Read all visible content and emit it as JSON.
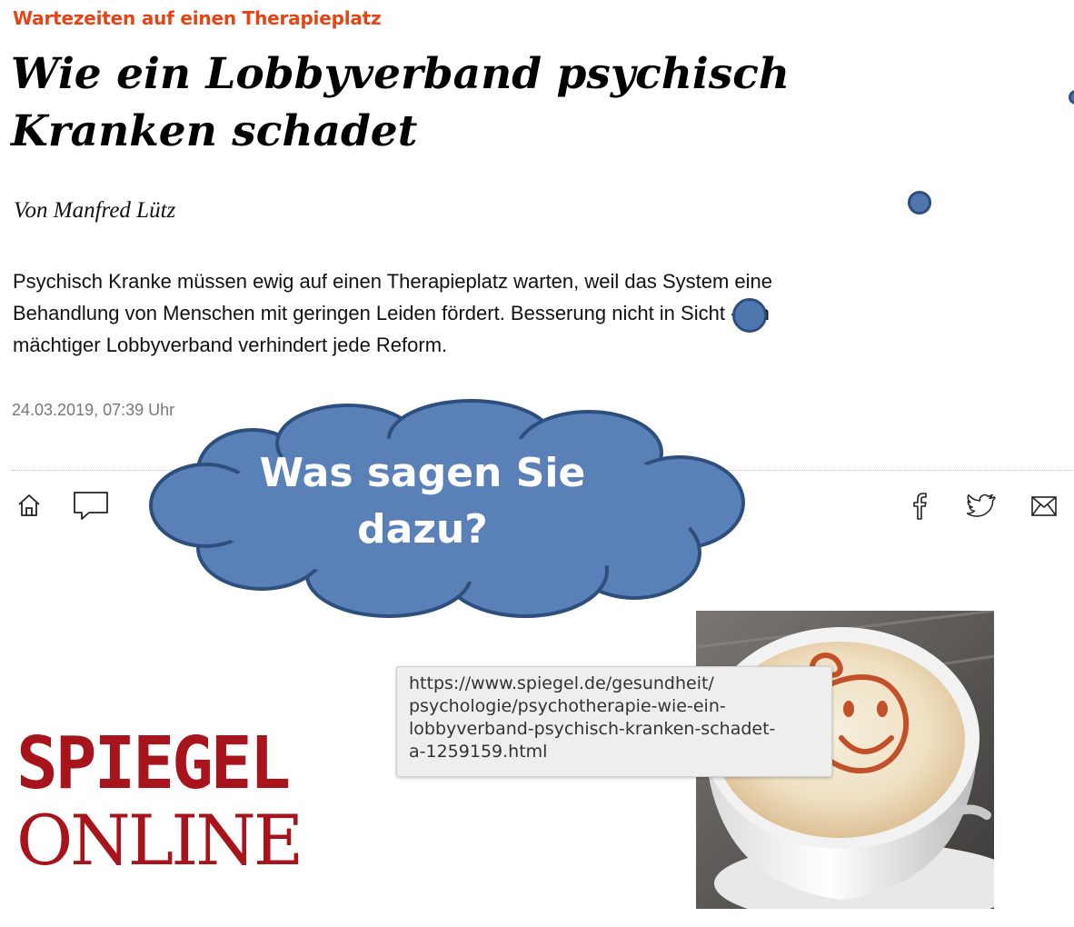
{
  "article": {
    "kicker": "Wartezeiten auf einen Therapieplatz",
    "headline": "Wie ein Lobbyverband psychisch Kranken schadet",
    "author": "Von Manfred Lütz",
    "teaser": "Psychisch Kranke müssen ewig auf einen Therapieplatz warten, weil das System eine Behandlung von Menschen mit geringen Leiden fördert. Besserung nicht in Sicht - ein mächtiger Lobbyverband verhindert jede Reform.",
    "date": "24.03.2019, 07:39 Uhr"
  },
  "toolbar": {
    "left_icons": [
      "home-icon",
      "comment-icon"
    ],
    "right_icons": [
      "facebook-icon",
      "twitter-icon",
      "mail-icon"
    ]
  },
  "callout": {
    "text": "Was sagen Sie dazu?",
    "fill_color": "#5a80b8",
    "stroke_color": "#2e4f7d"
  },
  "tooltip": {
    "url": "https://www.spiegel.de/gesundheit/\npsychologie/psychotherapie-wie-ein-\nlobbyverband-psychisch-kranken-schadet-\na-1259159.html"
  },
  "logo": {
    "line1": "SPIEGEL",
    "line2": "ONLINE",
    "color": "#a8141b"
  },
  "colors": {
    "kicker": "#e64415",
    "marker_dot": "#4f76ad"
  },
  "image": {
    "subject": "cappuccino-smiley-photo"
  }
}
